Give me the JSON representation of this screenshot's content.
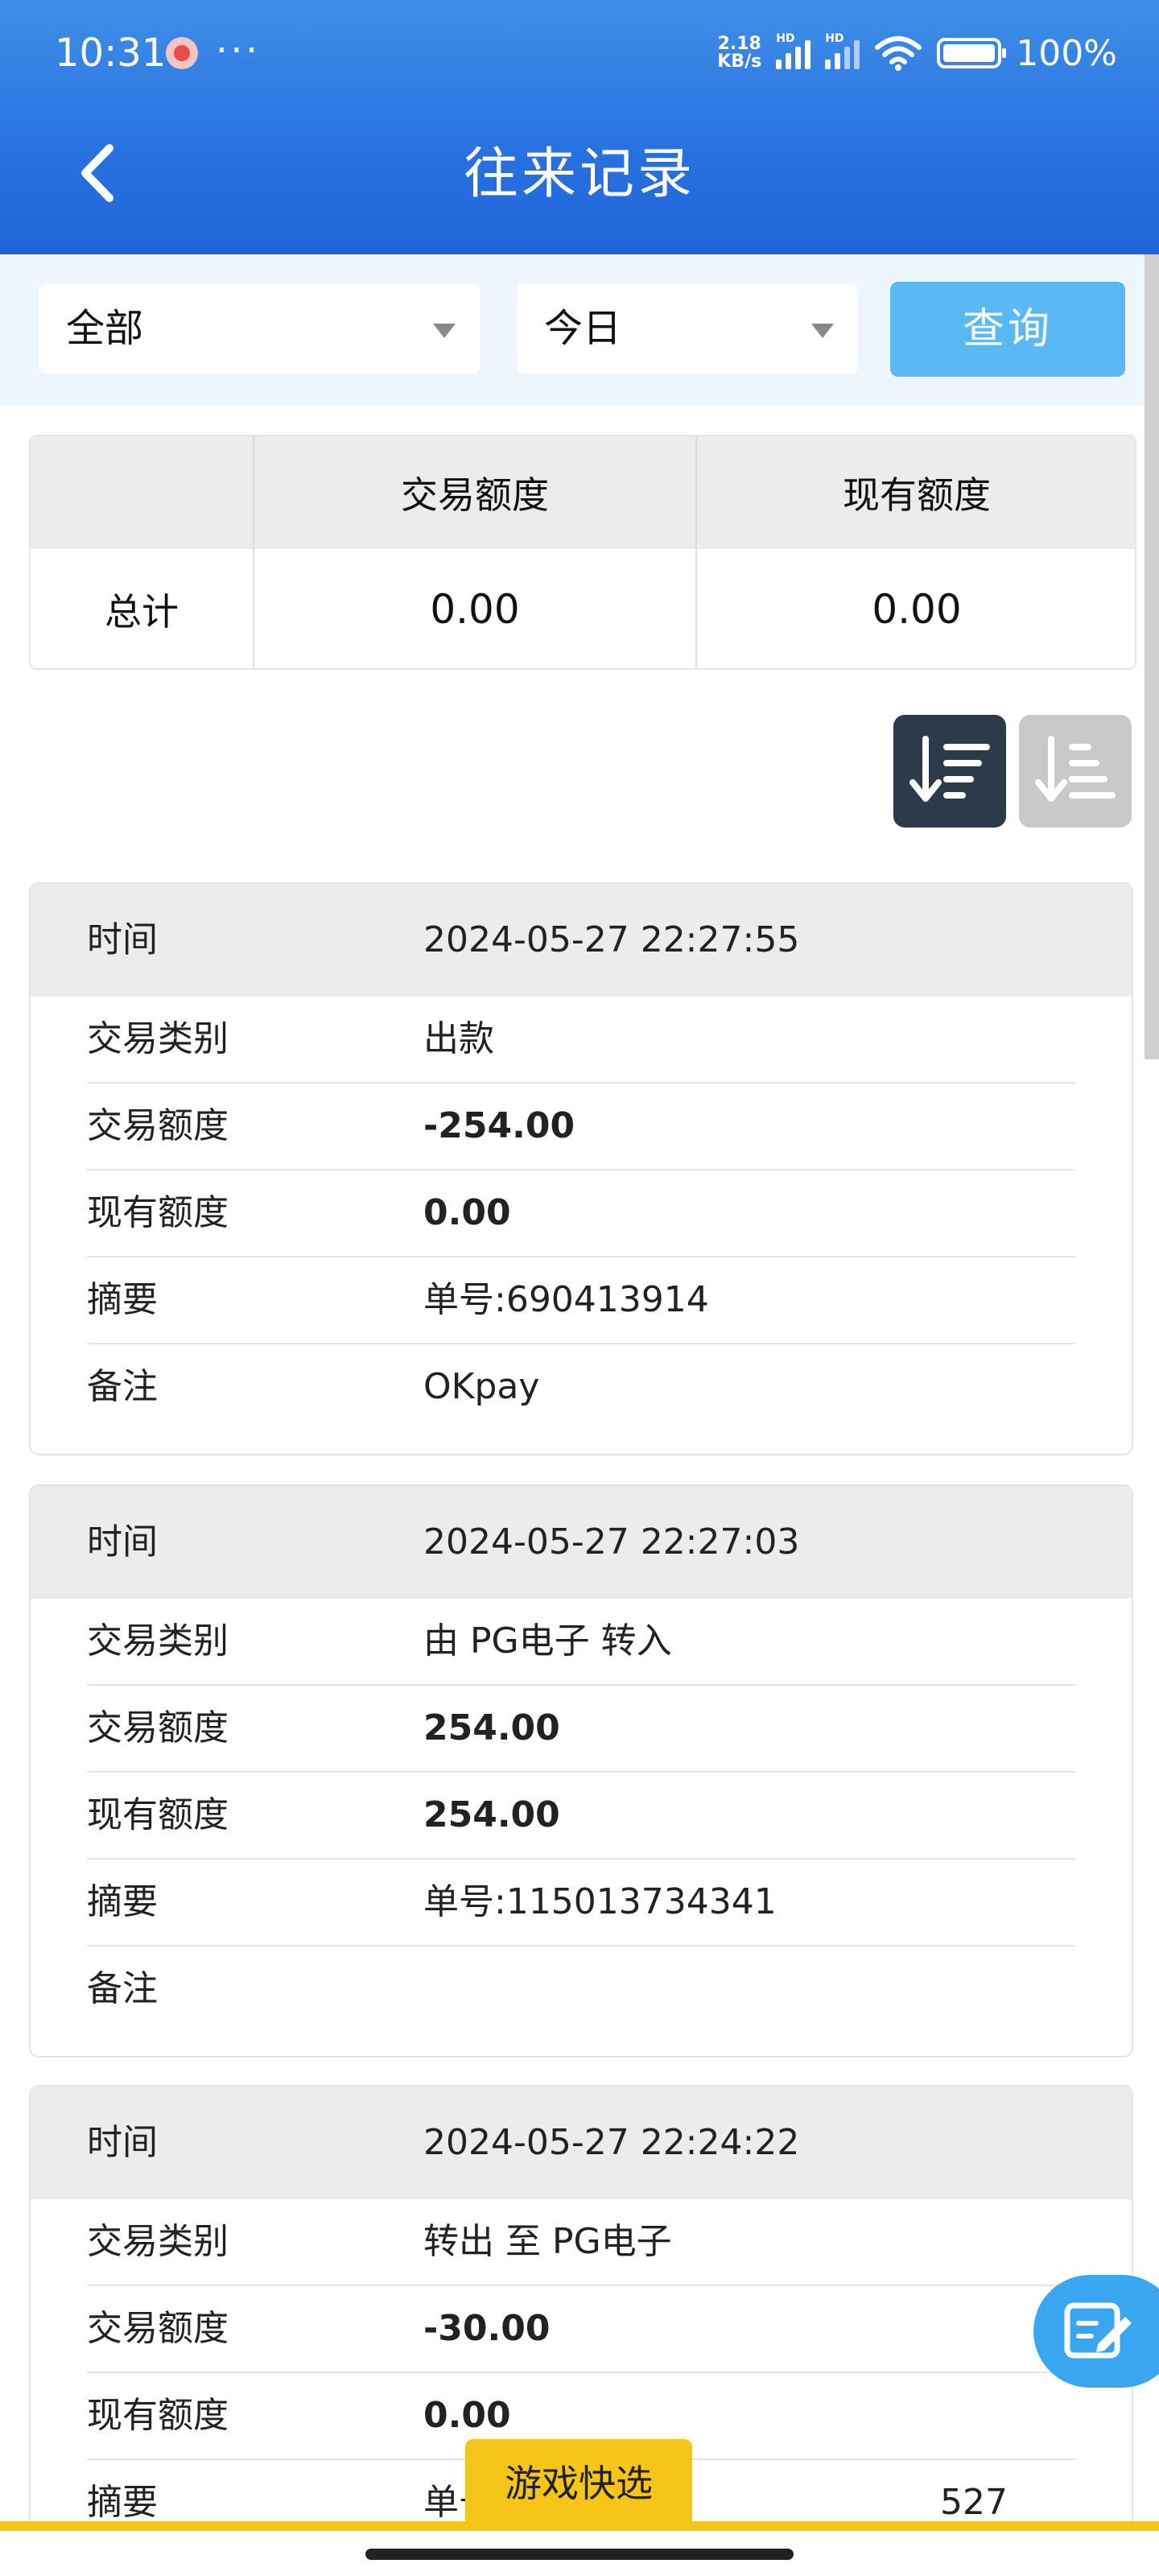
{
  "status": {
    "time": "10:31",
    "dots": "···",
    "speed_top": "2.18",
    "speed_bottom": "KB/s",
    "hd1": "HD",
    "hd2": "HD",
    "battery": "100%"
  },
  "header": {
    "title": "往来记录"
  },
  "filters": {
    "type": "全部",
    "period": "今日",
    "query": "查询"
  },
  "summary": {
    "headers": [
      "",
      "交易额度",
      "现有额度"
    ],
    "row_label": "总计",
    "values": [
      "0.00",
      "0.00"
    ]
  },
  "records": [
    {
      "time_label": "时间",
      "time": "2024-05-27 22:27:55",
      "fields": [
        {
          "label": "交易类别",
          "value": "出款"
        },
        {
          "label": "交易额度",
          "value": "-254.00"
        },
        {
          "label": "现有额度",
          "value": "0.00"
        },
        {
          "label": "摘要",
          "value": "单号:690413914"
        },
        {
          "label": "备注",
          "value": "OKpay"
        }
      ]
    },
    {
      "time_label": "时间",
      "time": "2024-05-27 22:27:03",
      "fields": [
        {
          "label": "交易类别",
          "value": "由 PG电子 转入"
        },
        {
          "label": "交易额度",
          "value": "254.00"
        },
        {
          "label": "现有额度",
          "value": "254.00"
        },
        {
          "label": "摘要",
          "value": "单号:115013734341"
        },
        {
          "label": "备注",
          "value": ""
        }
      ]
    },
    {
      "time_label": "时间",
      "time": "2024-05-27 22:24:22",
      "fields": [
        {
          "label": "交易类别",
          "value": "转出 至 PG电子"
        },
        {
          "label": "交易额度",
          "value": "-30.00"
        },
        {
          "label": "现有额度",
          "value": "0.00"
        },
        {
          "label": "摘要",
          "value": "单号"
        },
        {
          "label": "",
          "value": "527"
        }
      ]
    }
  ],
  "quick_game": "游戏快选",
  "colors": {
    "header": "#2a73e2",
    "query_button": "#5ab9f4",
    "quick_game": "#f5c518",
    "fab": "#3aa6ef"
  }
}
